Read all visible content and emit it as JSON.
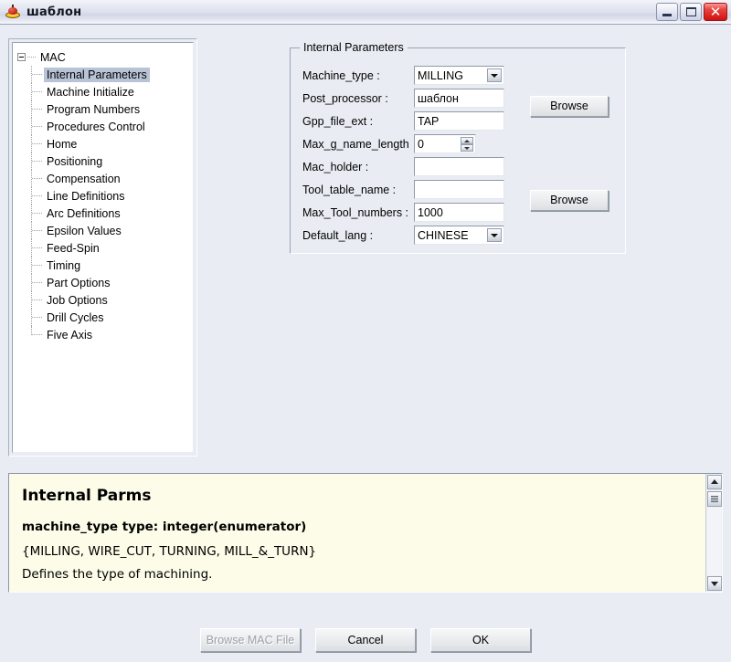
{
  "window": {
    "title": "шаблон",
    "icon": "app-icon",
    "controls": {
      "minimize": "minimize-button",
      "maximize": "maximize-button",
      "close": "close-button",
      "close_glyph": "✕"
    },
    "colors": {
      "background": "#e9edf3",
      "titlebar": "#dfe2ee",
      "close_button": "#cf1111",
      "selection": "#b9c3d6",
      "help_panel": "#fcfce9"
    }
  },
  "tree": {
    "root": {
      "label": "MAC",
      "expanded": true
    },
    "items": [
      {
        "label": "Internal Parameters",
        "selected": true
      },
      {
        "label": "Machine Initialize",
        "selected": false
      },
      {
        "label": "Program Numbers",
        "selected": false
      },
      {
        "label": "Procedures Control",
        "selected": false
      },
      {
        "label": "Home",
        "selected": false
      },
      {
        "label": "Positioning",
        "selected": false
      },
      {
        "label": "Compensation",
        "selected": false
      },
      {
        "label": "Line Definitions",
        "selected": false
      },
      {
        "label": "Arc Definitions",
        "selected": false
      },
      {
        "label": "Epsilon Values",
        "selected": false
      },
      {
        "label": "Feed-Spin",
        "selected": false
      },
      {
        "label": "Timing",
        "selected": false
      },
      {
        "label": "Part Options",
        "selected": false
      },
      {
        "label": "Job Options",
        "selected": false
      },
      {
        "label": "Drill Cycles",
        "selected": false
      },
      {
        "label": "Five Axis",
        "selected": false
      }
    ]
  },
  "group": {
    "title": "Internal Parameters",
    "fields": [
      {
        "label": "Machine_type :",
        "type": "combo",
        "value": "MILLING"
      },
      {
        "label": "Post_processor :",
        "type": "text",
        "value": "шаблон"
      },
      {
        "label": "Gpp_file_ext :",
        "type": "text",
        "value": "TAP"
      },
      {
        "label": "Max_g_name_length",
        "type": "spinner",
        "value": "0"
      },
      {
        "label": "Mac_holder :",
        "type": "text",
        "value": ""
      },
      {
        "label": "Tool_table_name :",
        "type": "text",
        "value": ""
      },
      {
        "label": "Max_Tool_numbers :",
        "type": "text",
        "value": "1000"
      },
      {
        "label": "Default_lang :",
        "type": "combo",
        "value": "CHINESE"
      }
    ],
    "browse_1_label": "Browse",
    "browse_2_label": "Browse"
  },
  "help": {
    "heading": "Internal Parms",
    "type_line": "machine_type type: integer(enumerator)",
    "enum_line": "{MILLING, WIRE_CUT, TURNING, MILL_&_TURN}",
    "description": "Defines the type of machining."
  },
  "footer": {
    "browse_mac_label": "Browse MAC File",
    "browse_mac_disabled": true,
    "cancel_label": "Cancel",
    "ok_label": "OK"
  }
}
